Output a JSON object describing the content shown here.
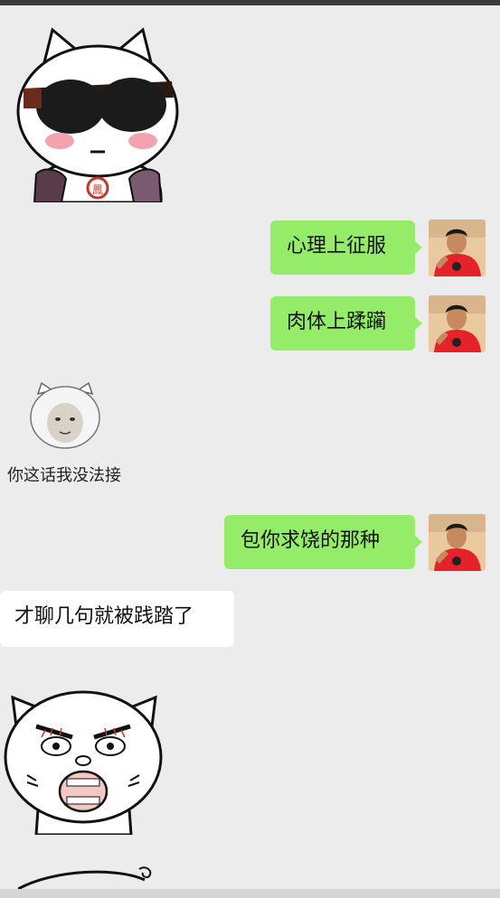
{
  "messages": [
    {
      "id": "m1",
      "type": "sticker",
      "side": "left",
      "sticker": "cat-sunglasses-sticker"
    },
    {
      "id": "m2",
      "type": "text",
      "side": "right",
      "text": "心理上征服"
    },
    {
      "id": "m3",
      "type": "text",
      "side": "right",
      "text": "肉体上蹂躏"
    },
    {
      "id": "m4",
      "type": "sticker",
      "side": "left",
      "sticker": "baby-face-sticker",
      "caption": "你这话我没法接"
    },
    {
      "id": "m5",
      "type": "text",
      "side": "right",
      "text": "包你求饶的那种"
    },
    {
      "id": "m6",
      "type": "text",
      "side": "left",
      "text": "才聊几句就被践踏了"
    },
    {
      "id": "m7",
      "type": "sticker",
      "side": "left",
      "sticker": "angry-face-sticker"
    },
    {
      "id": "m8",
      "type": "sticker",
      "side": "left",
      "sticker": "partial-sticker"
    }
  ],
  "colors": {
    "background": "#ececec",
    "outgoing_bubble": "#95ec69",
    "incoming_bubble": "#ffffff"
  }
}
